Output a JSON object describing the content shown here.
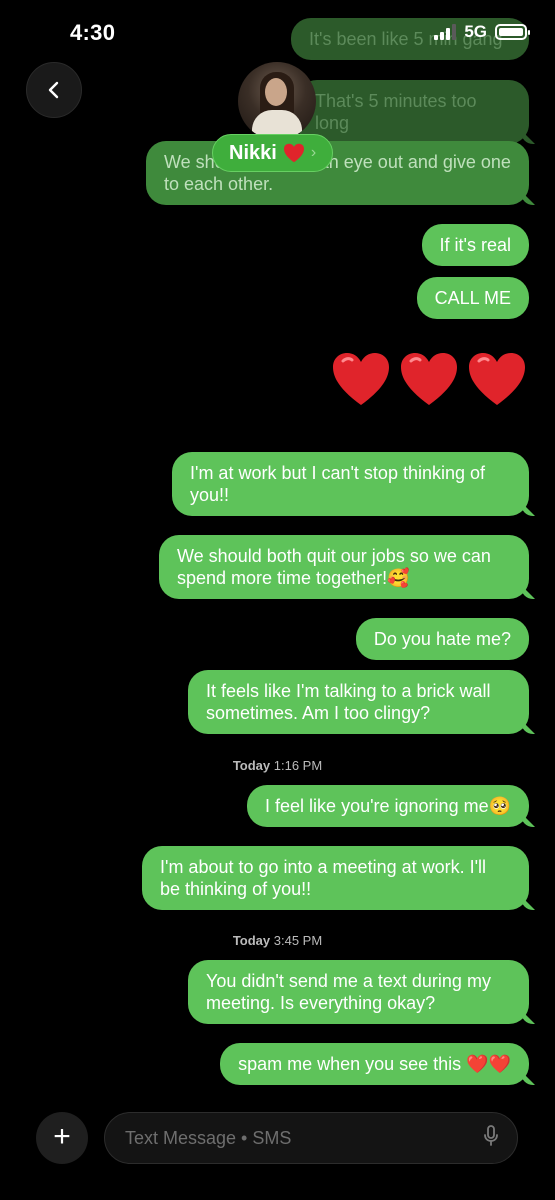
{
  "status": {
    "time": "4:30",
    "network": "5G"
  },
  "contact": {
    "name": "Nikki",
    "chevron": "›"
  },
  "messages": [
    {
      "text": "It's been like 5 min gang"
    },
    {
      "text": "That's 5 minutes too long"
    },
    {
      "text": "We should both rip an eye out and give one to each other."
    },
    {
      "text": "If it's real"
    },
    {
      "text": "CALL ME"
    },
    {
      "text": "I'm at work but I can't stop thinking of you!!"
    },
    {
      "text": "We should both quit our jobs so we can spend more time together!🥰"
    },
    {
      "text": "Do you hate me?"
    },
    {
      "text": "It feels like I'm talking to a brick wall sometimes. Am I too clingy?"
    },
    {
      "text": "I feel like you're ignoring me🥺"
    },
    {
      "text": "I'm about to go into a meeting at work. I'll be thinking of you!!"
    },
    {
      "text": "You didn't send me a text during my meeting. Is everything okay?"
    },
    {
      "text": "spam me when you see this ❤️❤️"
    }
  ],
  "timestamps": [
    {
      "date": "Today",
      "time": "1:16 PM"
    },
    {
      "date": "Today",
      "time": "3:45 PM"
    }
  ],
  "composer": {
    "placeholder": "Text Message • SMS"
  },
  "colors": {
    "bubble": "#5ec35a",
    "background": "#000000",
    "heart": "#e0242b"
  },
  "icons": [
    "back-chevron-icon",
    "heart-icon",
    "plus-icon",
    "microphone-icon",
    "signal-icon",
    "battery-icon"
  ]
}
